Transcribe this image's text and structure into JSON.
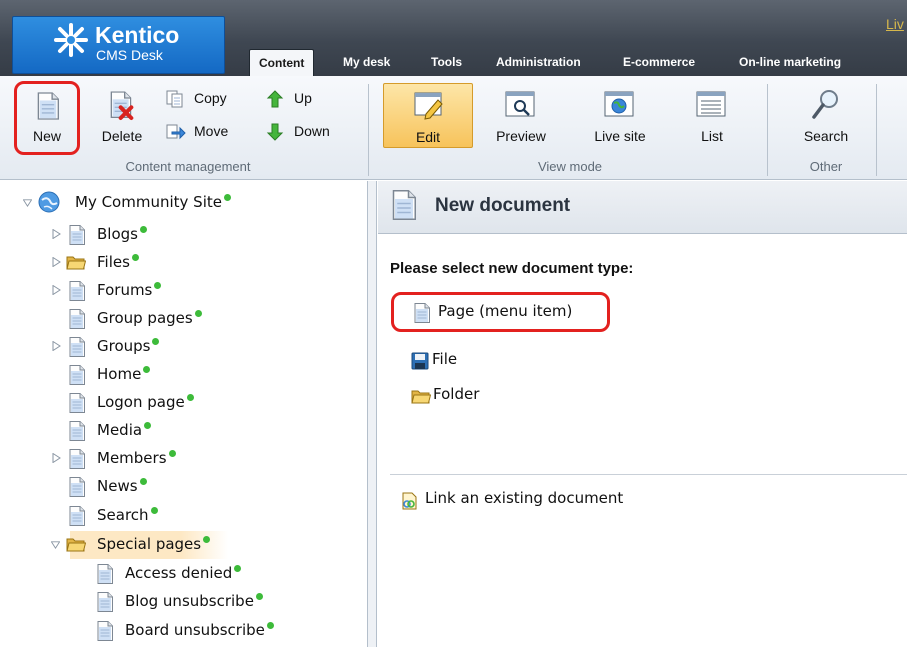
{
  "header": {
    "logo_name": "Kentico",
    "logo_product": "CMS Desk",
    "top_link": "Liv",
    "tabs": [
      {
        "label": "Content",
        "active": true
      },
      {
        "label": "My desk",
        "active": false
      },
      {
        "label": "Tools",
        "active": false
      },
      {
        "label": "Administration",
        "active": false
      },
      {
        "label": "E-commerce",
        "active": false
      },
      {
        "label": "On-line marketing",
        "active": false
      }
    ]
  },
  "toolbar": {
    "content_management": {
      "label": "Content management",
      "new": "New",
      "delete": "Delete",
      "copy": "Copy",
      "move": "Move",
      "up": "Up",
      "down": "Down"
    },
    "view_mode": {
      "label": "View mode",
      "edit": "Edit",
      "preview": "Preview",
      "live_site": "Live site",
      "list": "List"
    },
    "other": {
      "label": "Other",
      "search": "Search"
    }
  },
  "tree": {
    "root": "My Community Site",
    "nodes": [
      {
        "label": "Blogs",
        "expandable": true,
        "icon": "page-icon"
      },
      {
        "label": "Files",
        "expandable": true,
        "icon": "folder-icon"
      },
      {
        "label": "Forums",
        "expandable": true,
        "icon": "page-icon"
      },
      {
        "label": "Group pages",
        "expandable": false,
        "icon": "page-icon"
      },
      {
        "label": "Groups",
        "expandable": true,
        "icon": "page-icon"
      },
      {
        "label": "Home",
        "expandable": false,
        "icon": "page-icon"
      },
      {
        "label": "Logon page",
        "expandable": false,
        "icon": "page-icon"
      },
      {
        "label": "Media",
        "expandable": false,
        "icon": "page-icon"
      },
      {
        "label": "Members",
        "expandable": true,
        "icon": "page-icon"
      },
      {
        "label": "News",
        "expandable": false,
        "icon": "page-icon"
      },
      {
        "label": "Search",
        "expandable": false,
        "icon": "page-icon"
      },
      {
        "label": "Special pages",
        "expandable": true,
        "expanded": true,
        "selected": true,
        "icon": "folder-icon"
      }
    ],
    "children": [
      {
        "label": "Access denied"
      },
      {
        "label": "Blog unsubscribe"
      },
      {
        "label": "Board unsubscribe"
      }
    ]
  },
  "content": {
    "title": "New document",
    "prompt": "Please select new document type:",
    "types": [
      {
        "label": "Page (menu item)",
        "icon": "page-icon"
      },
      {
        "label": "File",
        "icon": "floppy-disk-icon"
      },
      {
        "label": "Folder",
        "icon": "folder-icon"
      }
    ],
    "link_existing": "Link an existing document"
  },
  "colors": {
    "header_bg": "#3f4752",
    "logo_blue": "#1469c4",
    "status_dot": "#3dbb3a",
    "highlight_ring": "#e3211f",
    "edit_active": "#f7c35b",
    "selected_node_bg": "#fde8c4"
  }
}
